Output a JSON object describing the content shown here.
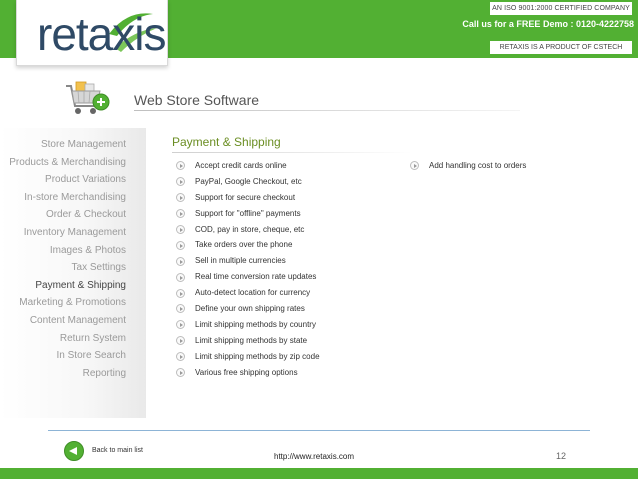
{
  "header": {
    "logo_text": "retaxis",
    "iso_text": "AN ISO 9001:2000 CERTIFIED COMPANY",
    "demo_text": "Call us for a FREE Demo : 0120-4222758",
    "product_text": "RETAXIS IS A PRODUCT OF CSTECH"
  },
  "page": {
    "title": "Web Store Software",
    "cart_icon": "shopping-cart-add-icon"
  },
  "sidebar": {
    "items": [
      {
        "label": "Store Management",
        "active": false
      },
      {
        "label": "Products & Merchandising",
        "active": false
      },
      {
        "label": "Product Variations",
        "active": false
      },
      {
        "label": "In-store Merchandising",
        "active": false
      },
      {
        "label": "Order & Checkout",
        "active": false
      },
      {
        "label": "Inventory Management",
        "active": false
      },
      {
        "label": "Images & Photos",
        "active": false
      },
      {
        "label": "Tax Settings",
        "active": false
      },
      {
        "label": "Payment & Shipping",
        "active": true
      },
      {
        "label": "Marketing & Promotions",
        "active": false
      },
      {
        "label": "Content Management",
        "active": false
      },
      {
        "label": "Return System",
        "active": false
      },
      {
        "label": "In Store Search",
        "active": false
      },
      {
        "label": "Reporting",
        "active": false
      }
    ]
  },
  "section": {
    "title": "Payment & Shipping",
    "features_left": [
      "Accept credit cards online",
      "PayPal, Google Checkout, etc",
      "Support for secure checkout",
      "Support for \"offline\" payments",
      "COD, pay in store, cheque, etc",
      "Take orders over the phone",
      "Sell in multiple currencies",
      "Real time conversion rate updates",
      "Auto-detect location for currency",
      "Define your own shipping rates",
      "Limit shipping methods by country",
      "Limit shipping methods by state",
      "Limit shipping methods by zip code",
      "Various free shipping options"
    ],
    "features_right": [
      "Add handling cost to orders"
    ]
  },
  "footer": {
    "back_label": "Back to main list",
    "back_icon": "arrow-left-icon",
    "url": "http://www.retaxis.com",
    "page_number": "12"
  },
  "colors": {
    "brand_green": "#52b033",
    "section_title": "#6b8e23",
    "logo_blue": "#2f4a66"
  }
}
